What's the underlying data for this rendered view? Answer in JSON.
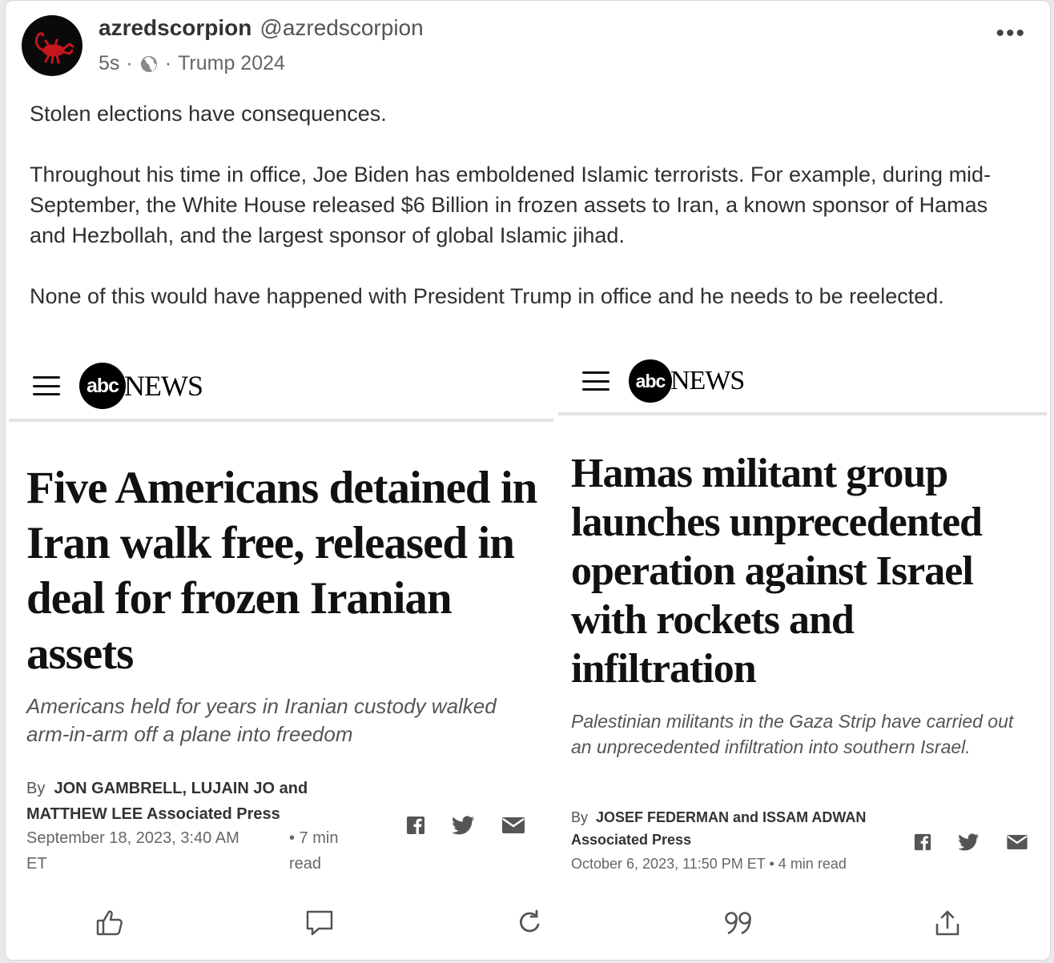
{
  "post": {
    "display_name": "azredscorpion",
    "handle": "@azredscorpion",
    "time": "5s",
    "sep1": "·",
    "sep2": "·",
    "group": "Trump 2024",
    "more": "•••",
    "paragraphs": [
      "Stolen elections have consequences.",
      "Throughout his time in office, Joe Biden has emboldened Islamic terrorists. For example, during mid-September, the White House released $6 Billion in frozen assets to Iran, a known sponsor of Hamas and Hezbollah, and the largest sponsor of global Islamic jihad.",
      "None of this would have happened with President Trump in office and he needs to be reelected."
    ]
  },
  "articles": [
    {
      "logo_abc": "abc",
      "logo_news": "NEWS",
      "headline": "Five Americans detained in Iran walk free, released in deal for frozen Iranian assets",
      "dek": "Americans held for years in Iranian custody walked arm-in-arm off a plane into freedom",
      "by": "By",
      "authors_line1": "JON GAMBRELL, LUJAIN JO and",
      "authors_line2": "MATTHEW LEE Associated Press",
      "date_line1": "September 18, 2023, 3:40 AM",
      "date_line2": "ET",
      "read_line1": "• 7 min",
      "read_line2": "read"
    },
    {
      "logo_abc": "abc",
      "logo_news": "NEWS",
      "headline": "Hamas militant group launches unprecedented operation against Israel with rockets and infiltration",
      "dek": "Palestinian militants in the Gaza Strip have carried out an unprecedented infiltration into southern Israel.",
      "by": "By",
      "authors_line1": "JOSEF FEDERMAN and ISSAM ADWAN",
      "authors_line2": "Associated Press",
      "date_line1": "October 6, 2023, 11:50 PM ET",
      "read_line1": "• 4 min read"
    }
  ],
  "icons": {
    "like": "thumbs-up-icon",
    "comment": "comment-icon",
    "repost": "repost-icon",
    "quote": "quote-icon",
    "share": "share-icon"
  },
  "colors": {
    "avatar_bg": "#0a0a0a",
    "scorpion": "#c4161c",
    "text": "#2f2f2f"
  }
}
